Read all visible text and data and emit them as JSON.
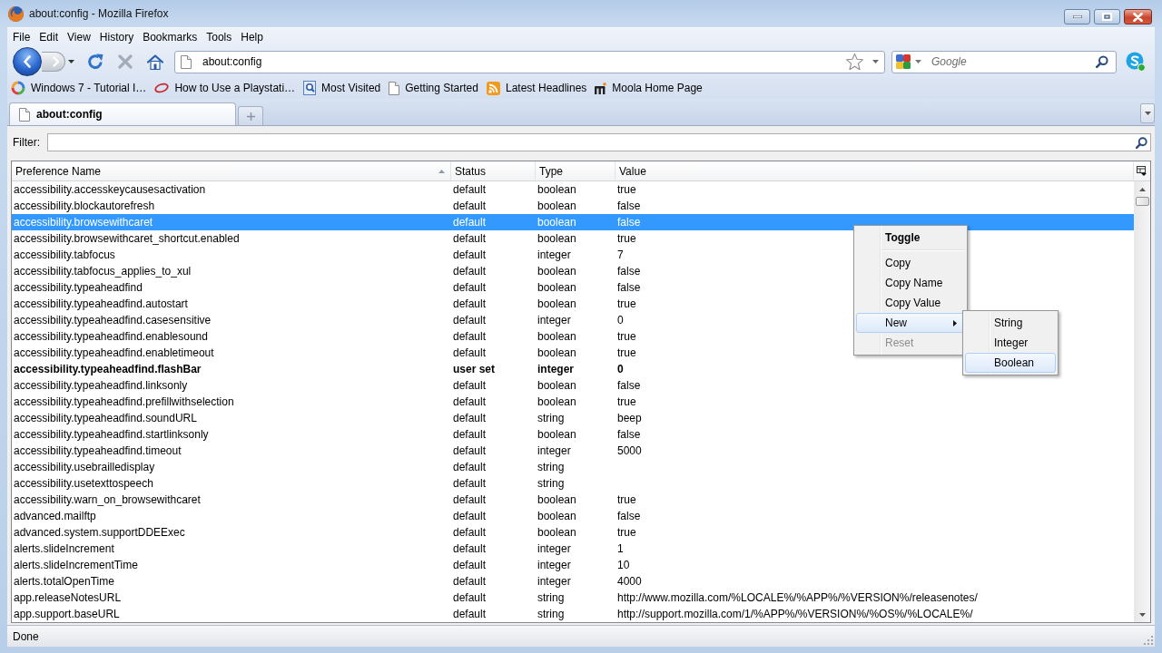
{
  "window": {
    "title": "about:config - Mozilla Firefox"
  },
  "menu_bar": [
    "File",
    "Edit",
    "View",
    "History",
    "Bookmarks",
    "Tools",
    "Help"
  ],
  "navigation": {
    "address": "about:config",
    "search": {
      "placeholder": "Google"
    }
  },
  "bookmarks": [
    {
      "label": "Windows 7 - Tutorial I…",
      "kind": "swirl"
    },
    {
      "label": "How to Use a Playstati…",
      "kind": "swoosh"
    },
    {
      "label": "Most Visited",
      "kind": "search"
    },
    {
      "label": "Getting Started",
      "kind": "page"
    },
    {
      "label": "Latest Headlines",
      "kind": "feed"
    },
    {
      "label": "Moola Home Page",
      "kind": "monogram"
    }
  ],
  "tabs": [
    {
      "label": "about:config",
      "selected": true
    }
  ],
  "filter": {
    "label": "Filter:"
  },
  "table": {
    "columns": [
      {
        "label": "Preference Name",
        "sorted": true
      },
      {
        "label": "Status",
        "sorted": false
      },
      {
        "label": "Type",
        "sorted": false
      },
      {
        "label": "Value",
        "sorted": false
      }
    ],
    "rows": [
      {
        "name": "accessibility.accesskeycausesactivation",
        "status": "default",
        "type": "boolean",
        "value": "true",
        "selected": false,
        "modified": false
      },
      {
        "name": "accessibility.blockautorefresh",
        "status": "default",
        "type": "boolean",
        "value": "false",
        "selected": false,
        "modified": false
      },
      {
        "name": "accessibility.browsewithcaret",
        "status": "default",
        "type": "boolean",
        "value": "false",
        "selected": true,
        "modified": false
      },
      {
        "name": "accessibility.browsewithcaret_shortcut.enabled",
        "status": "default",
        "type": "boolean",
        "value": "true",
        "selected": false,
        "modified": false
      },
      {
        "name": "accessibility.tabfocus",
        "status": "default",
        "type": "integer",
        "value": "7",
        "selected": false,
        "modified": false
      },
      {
        "name": "accessibility.tabfocus_applies_to_xul",
        "status": "default",
        "type": "boolean",
        "value": "false",
        "selected": false,
        "modified": false
      },
      {
        "name": "accessibility.typeaheadfind",
        "status": "default",
        "type": "boolean",
        "value": "false",
        "selected": false,
        "modified": false
      },
      {
        "name": "accessibility.typeaheadfind.autostart",
        "status": "default",
        "type": "boolean",
        "value": "true",
        "selected": false,
        "modified": false
      },
      {
        "name": "accessibility.typeaheadfind.casesensitive",
        "status": "default",
        "type": "integer",
        "value": "0",
        "selected": false,
        "modified": false
      },
      {
        "name": "accessibility.typeaheadfind.enablesound",
        "status": "default",
        "type": "boolean",
        "value": "true",
        "selected": false,
        "modified": false
      },
      {
        "name": "accessibility.typeaheadfind.enabletimeout",
        "status": "default",
        "type": "boolean",
        "value": "true",
        "selected": false,
        "modified": false
      },
      {
        "name": "accessibility.typeaheadfind.flashBar",
        "status": "user set",
        "type": "integer",
        "value": "0",
        "selected": false,
        "modified": true
      },
      {
        "name": "accessibility.typeaheadfind.linksonly",
        "status": "default",
        "type": "boolean",
        "value": "false",
        "selected": false,
        "modified": false
      },
      {
        "name": "accessibility.typeaheadfind.prefillwithselection",
        "status": "default",
        "type": "boolean",
        "value": "true",
        "selected": false,
        "modified": false
      },
      {
        "name": "accessibility.typeaheadfind.soundURL",
        "status": "default",
        "type": "string",
        "value": "beep",
        "selected": false,
        "modified": false
      },
      {
        "name": "accessibility.typeaheadfind.startlinksonly",
        "status": "default",
        "type": "boolean",
        "value": "false",
        "selected": false,
        "modified": false
      },
      {
        "name": "accessibility.typeaheadfind.timeout",
        "status": "default",
        "type": "integer",
        "value": "5000",
        "selected": false,
        "modified": false
      },
      {
        "name": "accessibility.usebrailledisplay",
        "status": "default",
        "type": "string",
        "selected": false,
        "modified": false
      },
      {
        "name": "accessibility.usetexttospeech",
        "status": "default",
        "type": "string",
        "selected": false,
        "modified": false
      },
      {
        "name": "accessibility.warn_on_browsewithcaret",
        "status": "default",
        "type": "boolean",
        "value": "true",
        "selected": false,
        "modified": false
      },
      {
        "name": "advanced.mailftp",
        "status": "default",
        "type": "boolean",
        "value": "false",
        "selected": false,
        "modified": false
      },
      {
        "name": "advanced.system.supportDDEExec",
        "status": "default",
        "type": "boolean",
        "value": "true",
        "selected": false,
        "modified": false
      },
      {
        "name": "alerts.slideIncrement",
        "status": "default",
        "type": "integer",
        "value": "1",
        "selected": false,
        "modified": false
      },
      {
        "name": "alerts.slideIncrementTime",
        "status": "default",
        "type": "integer",
        "value": "10",
        "selected": false,
        "modified": false
      },
      {
        "name": "alerts.totalOpenTime",
        "status": "default",
        "type": "integer",
        "value": "4000",
        "selected": false,
        "modified": false
      },
      {
        "name": "app.releaseNotesURL",
        "status": "default",
        "type": "string",
        "value": "http://www.mozilla.com/%LOCALE%/%APP%/%VERSION%/releasenotes/",
        "selected": false,
        "modified": false
      },
      {
        "name": "app.support.baseURL",
        "status": "default",
        "type": "string",
        "value": "http://support.mozilla.com/1/%APP%/%VERSION%/%OS%/%LOCALE%/",
        "selected": false,
        "modified": false
      }
    ]
  },
  "context_menu": {
    "items": [
      {
        "kind": "item",
        "label": "Toggle",
        "default": true,
        "disabled": false,
        "selected": false
      },
      {
        "kind": "separator"
      },
      {
        "kind": "item",
        "label": "Copy",
        "default": false,
        "disabled": false,
        "selected": false
      },
      {
        "kind": "item",
        "label": "Copy Name",
        "default": false,
        "disabled": false,
        "selected": false
      },
      {
        "kind": "item",
        "label": "Copy Value",
        "default": false,
        "disabled": false,
        "selected": false
      },
      {
        "kind": "submenu",
        "label": "New",
        "default": false,
        "disabled": false,
        "selected": true,
        "expanded": true,
        "children": [
          {
            "label": "String",
            "selected": false
          },
          {
            "label": "Integer",
            "selected": false
          },
          {
            "label": "Boolean",
            "selected": true
          }
        ]
      },
      {
        "kind": "item",
        "label": "Reset",
        "default": false,
        "disabled": true,
        "selected": false
      }
    ]
  },
  "status_bar": {
    "text": "Done"
  }
}
